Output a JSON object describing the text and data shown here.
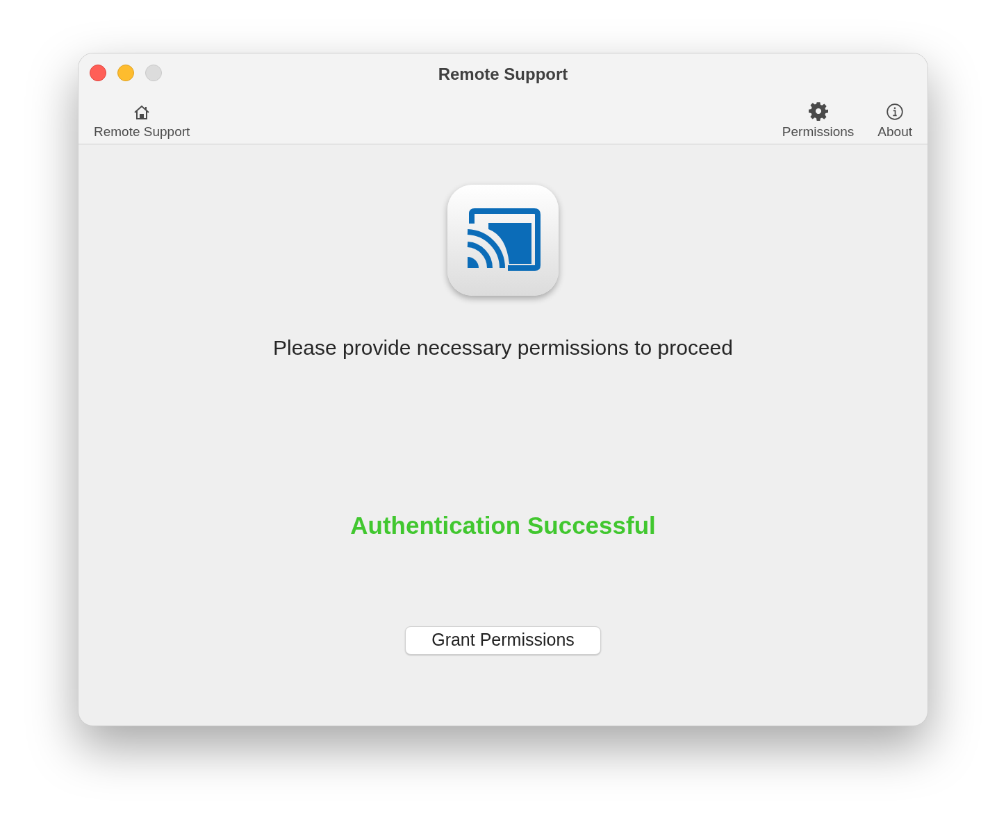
{
  "window": {
    "title": "Remote Support"
  },
  "toolbar": {
    "left": [
      {
        "kind": "home",
        "label": "Remote Support"
      }
    ],
    "right": [
      {
        "kind": "gear",
        "label": "Permissions"
      },
      {
        "kind": "info",
        "label": "About"
      }
    ]
  },
  "message": "Please provide necessary permissions to proceed",
  "status": "Authentication Successful",
  "button": "Grant Permissions"
}
